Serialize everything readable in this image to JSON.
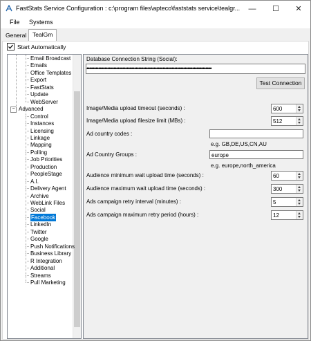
{
  "window": {
    "title": "FastStats Service Configuration : c:\\program files\\apteco\\faststats service\\tealgr...",
    "minimize": "—",
    "maximize": "☐",
    "close": "✕"
  },
  "menu": [
    "File",
    "Systems"
  ],
  "tabs": {
    "general": "General",
    "active": "TealGm"
  },
  "start_automatically": {
    "label": "Start Automatically",
    "checked": true
  },
  "tree": {
    "top_items": [
      "Email Broadcast",
      "Emails",
      "Office Templates",
      "Export",
      "FastStats",
      "Update",
      "WebServer"
    ],
    "group": "Advanced",
    "group_expander": "−",
    "advanced_items": [
      "Control",
      "Instances",
      "Licensing",
      "Linkage",
      "Mapping",
      "Polling",
      "Job Priorities",
      "Production",
      "PeopleStage",
      "A.I.",
      "Delivery Agent",
      "Archive",
      "WebLink Files",
      "Social",
      "Facebook",
      "LinkedIn",
      "Twitter",
      "Google",
      "Push Notifications",
      "Business Library",
      "R Integration",
      "Additional",
      "Streams",
      "Pull Marketing"
    ],
    "selected": "Facebook"
  },
  "settings": {
    "db_label": "Database Connection String (Social):",
    "db_value": "••••••••••••••••••••••••••••••••••••••••••••••••••••••••••••••••••••••••••••••••••••",
    "test_connection": "Test Connection",
    "upload_timeout_label": "Image/Media upload timeout (seconds) :",
    "upload_timeout": "600",
    "filesize_label": "Image/Media upload filesize limit (MBs) :",
    "filesize": "512",
    "country_codes_label": "Ad country codes :",
    "country_codes": "",
    "country_codes_hint": "e.g. GB,DE,US,CN,AU",
    "country_groups_label": "Ad Country Groups :",
    "country_groups": "europe",
    "country_groups_hint": "e.g. europe,north_america",
    "aud_min_label": "Audience minimum wait upload time (seconds) :",
    "aud_min": "60",
    "aud_max_label": "Audience maximum wait upload time (seconds) :",
    "aud_max": "300",
    "retry_interval_label": "Ads campaign retry interval (minutes) :",
    "retry_interval": "5",
    "retry_max_label": "Ads campaign maximum retry period (hours) :",
    "retry_max": "12"
  }
}
